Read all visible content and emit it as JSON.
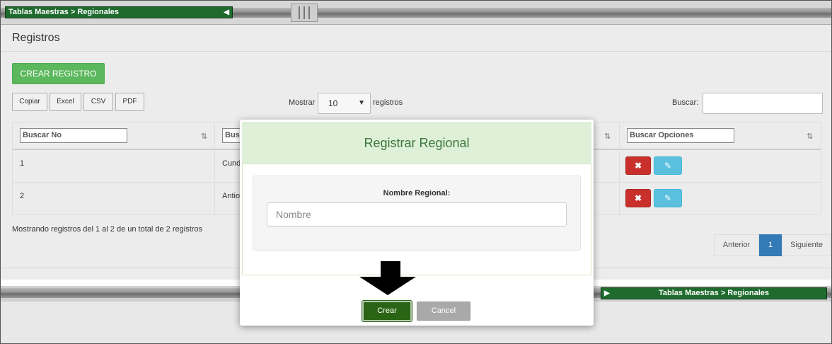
{
  "breadcrumb": {
    "text": "Tablas Maestras > Regionales"
  },
  "page": {
    "title": "Registros"
  },
  "toolbar": {
    "create_record_label": "CREAR REGISTRO",
    "export_buttons": [
      "Copiar",
      "Excel",
      "CSV",
      "PDF"
    ],
    "show_label": "Mostrar",
    "page_length": "10",
    "records_label": "registros",
    "search_label": "Buscar:",
    "search_value": ""
  },
  "table": {
    "filters": [
      "Buscar No",
      "Busc",
      "Buscar Opciones"
    ],
    "rows": [
      {
        "no": "1",
        "name": "Cund"
      },
      {
        "no": "2",
        "name": "Antio"
      }
    ],
    "info": "Mostrando registros del 1 al 2 de un total de 2 registros"
  },
  "pagination": {
    "prev": "Anterior",
    "current": "1",
    "next": "Siguiente",
    "active_color": "#337ab7"
  },
  "modal": {
    "title": "Registrar Regional",
    "field_label": "Nombre Regional:",
    "field_placeholder": "Nombre",
    "field_value": "",
    "submit_label": "Crear",
    "cancel_label": "Cancel",
    "header_color": "#dff0d8",
    "submit_color": "#2a6415"
  },
  "icons": {
    "delete": "times-icon",
    "edit": "edit-icon",
    "sort": "sort-icon",
    "collapse": "triangle-left-icon",
    "expand": "triangle-right-icon",
    "pointer": "down-arrow-icon"
  }
}
